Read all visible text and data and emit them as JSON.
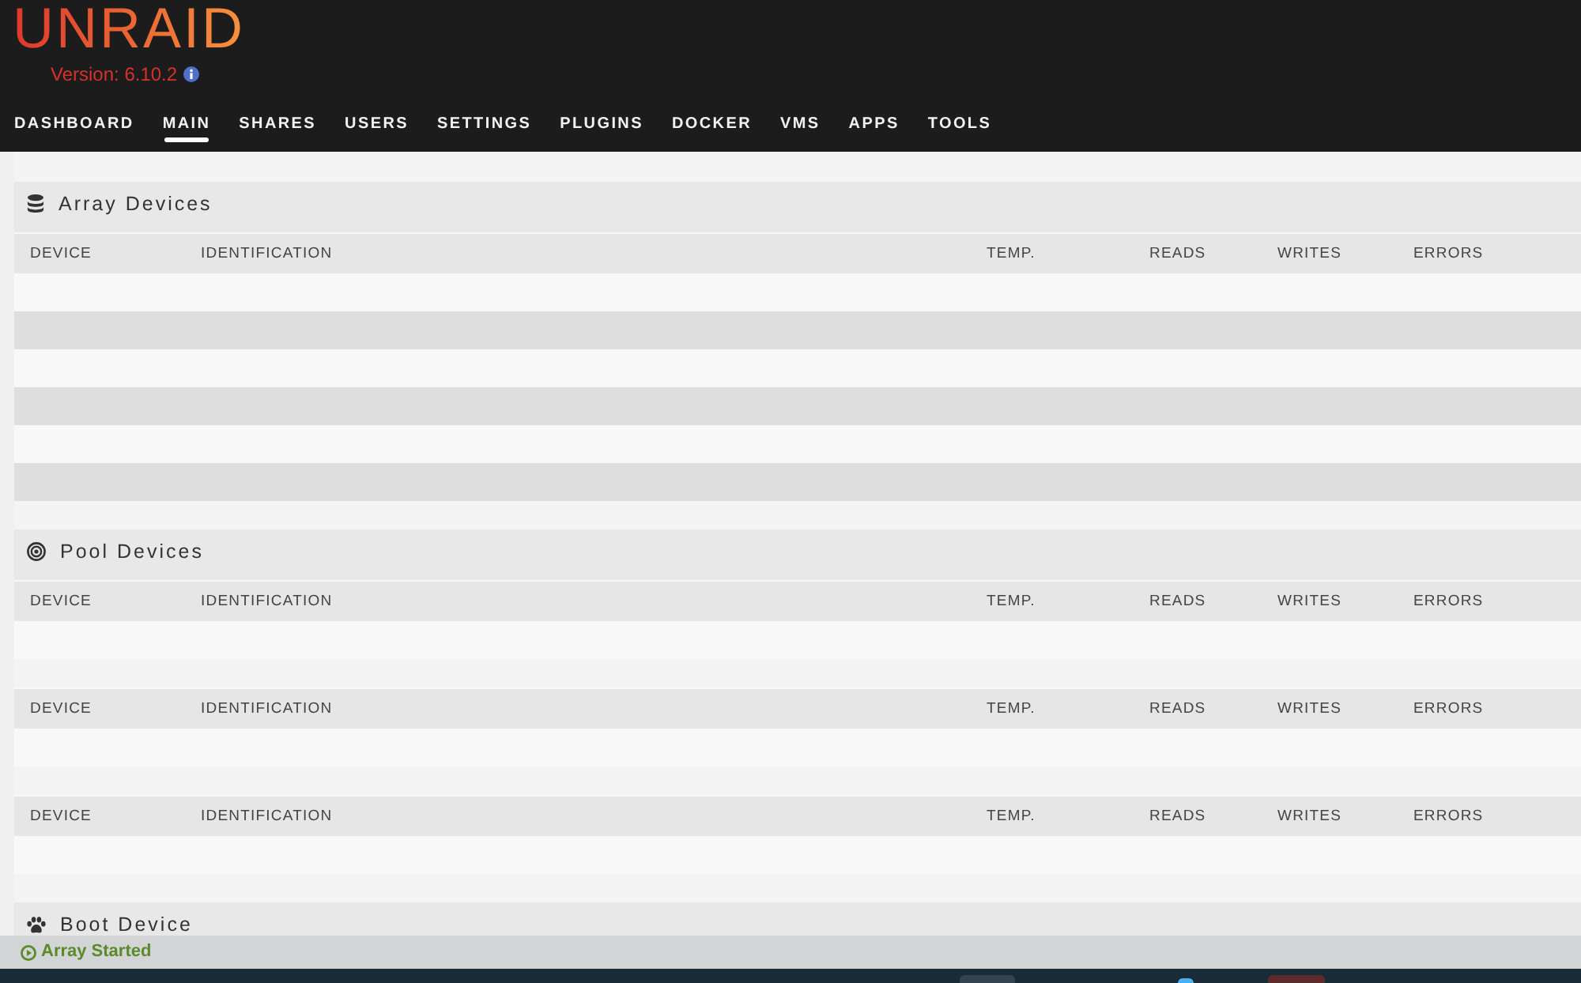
{
  "header": {
    "logo": "UNRAID",
    "version": "Version: 6.10.2"
  },
  "nav": [
    {
      "label": "DASHBOARD",
      "selected": false
    },
    {
      "label": "MAIN",
      "selected": true
    },
    {
      "label": "SHARES",
      "selected": false
    },
    {
      "label": "USERS",
      "selected": false
    },
    {
      "label": "SETTINGS",
      "selected": false
    },
    {
      "label": "PLUGINS",
      "selected": false
    },
    {
      "label": "DOCKER",
      "selected": false
    },
    {
      "label": "VMS",
      "selected": false
    },
    {
      "label": "APPS",
      "selected": false
    },
    {
      "label": "TOOLS",
      "selected": false
    }
  ],
  "sections": [
    {
      "kind": "array",
      "title": "Array Devices",
      "tables": [
        {
          "columns": [
            "DEVICE",
            "IDENTIFICATION",
            "TEMP.",
            "READS",
            "WRITES",
            "ERRORS"
          ],
          "rows": [
            {
              "striped": false
            },
            {
              "striped": true
            },
            {
              "striped": false
            },
            {
              "striped": true
            },
            {
              "striped": false
            },
            {
              "striped": true
            }
          ]
        }
      ]
    },
    {
      "kind": "pool",
      "title": "Pool Devices",
      "tables": [
        {
          "columns": [
            "DEVICE",
            "IDENTIFICATION",
            "TEMP.",
            "READS",
            "WRITES",
            "ERRORS"
          ],
          "rows": [
            {
              "striped": false
            }
          ]
        },
        {
          "columns": [
            "DEVICE",
            "IDENTIFICATION",
            "TEMP.",
            "READS",
            "WRITES",
            "ERRORS"
          ],
          "rows": [
            {
              "striped": false
            }
          ]
        },
        {
          "columns": [
            "DEVICE",
            "IDENTIFICATION",
            "TEMP.",
            "READS",
            "WRITES",
            "ERRORS"
          ],
          "rows": [
            {
              "striped": false
            }
          ]
        }
      ]
    },
    {
      "kind": "boot",
      "title": "Boot Device"
    }
  ],
  "status_bar": {
    "text": "Array Started"
  }
}
